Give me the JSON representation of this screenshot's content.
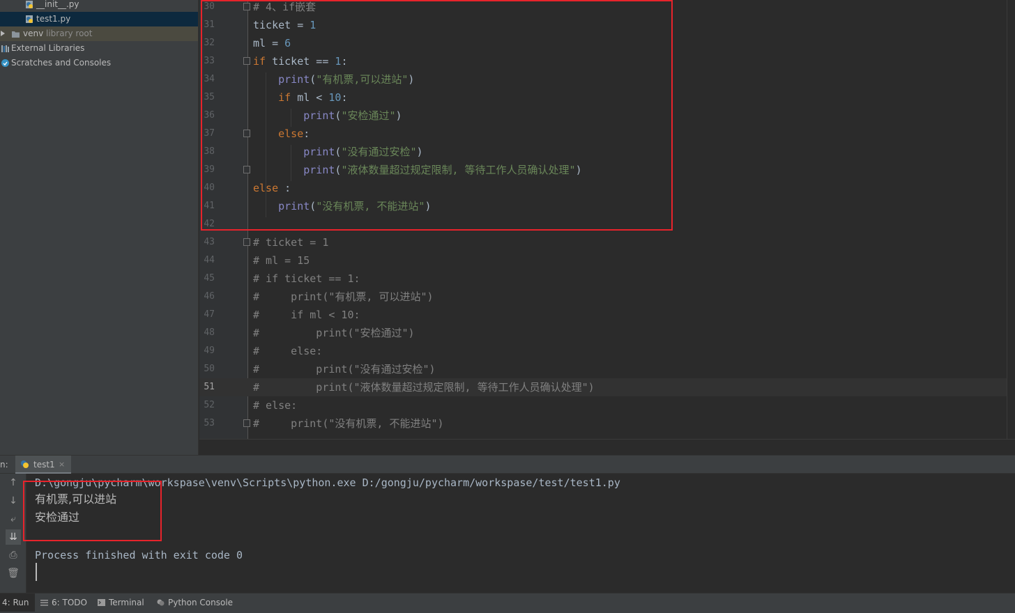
{
  "project_tree": {
    "items": [
      {
        "label": "__init__.py",
        "icon": "python-file-icon"
      },
      {
        "label": "test1.py",
        "icon": "python-file-icon"
      },
      {
        "label": "venv",
        "hint": "library root",
        "icon": "folder-icon"
      },
      {
        "label": "External Libraries",
        "icon": "libraries-icon"
      },
      {
        "label": "Scratches and Consoles",
        "icon": "scratches-icon"
      }
    ]
  },
  "editor": {
    "current_line": "51",
    "lines": [
      {
        "n": "30",
        "tokens": [
          {
            "t": "# 4、if嵌套",
            "c": "cmt"
          }
        ]
      },
      {
        "n": "31",
        "tokens": [
          {
            "t": "ticket = ",
            "c": ""
          },
          {
            "t": "1",
            "c": "num"
          }
        ]
      },
      {
        "n": "32",
        "tokens": [
          {
            "t": "ml = ",
            "c": ""
          },
          {
            "t": "6",
            "c": "num"
          }
        ]
      },
      {
        "n": "33",
        "tokens": [
          {
            "t": "if ",
            "c": "kw"
          },
          {
            "t": "ticket == ",
            "c": ""
          },
          {
            "t": "1",
            "c": "num"
          },
          {
            "t": ":",
            "c": ""
          }
        ]
      },
      {
        "n": "34",
        "tokens": [
          {
            "t": "    ",
            "c": ""
          },
          {
            "t": "print",
            "c": "fn"
          },
          {
            "t": "(",
            "c": ""
          },
          {
            "t": "\"有机票,可以进站\"",
            "c": "str"
          },
          {
            "t": ")",
            "c": ""
          }
        ]
      },
      {
        "n": "35",
        "tokens": [
          {
            "t": "    ",
            "c": ""
          },
          {
            "t": "if ",
            "c": "kw"
          },
          {
            "t": "ml < ",
            "c": ""
          },
          {
            "t": "10",
            "c": "num"
          },
          {
            "t": ":",
            "c": ""
          }
        ]
      },
      {
        "n": "36",
        "tokens": [
          {
            "t": "        ",
            "c": ""
          },
          {
            "t": "print",
            "c": "fn"
          },
          {
            "t": "(",
            "c": ""
          },
          {
            "t": "\"安检通过\"",
            "c": "str"
          },
          {
            "t": ")",
            "c": ""
          }
        ]
      },
      {
        "n": "37",
        "tokens": [
          {
            "t": "    ",
            "c": ""
          },
          {
            "t": "else",
            "c": "kw"
          },
          {
            "t": ":",
            "c": ""
          }
        ]
      },
      {
        "n": "38",
        "tokens": [
          {
            "t": "        ",
            "c": ""
          },
          {
            "t": "print",
            "c": "fn"
          },
          {
            "t": "(",
            "c": ""
          },
          {
            "t": "\"没有通过安检\"",
            "c": "str"
          },
          {
            "t": ")",
            "c": ""
          }
        ]
      },
      {
        "n": "39",
        "tokens": [
          {
            "t": "        ",
            "c": ""
          },
          {
            "t": "print",
            "c": "fn"
          },
          {
            "t": "(",
            "c": ""
          },
          {
            "t": "\"液体数量超过规定限制, 等待工作人员确认处理\"",
            "c": "str"
          },
          {
            "t": ")",
            "c": ""
          }
        ]
      },
      {
        "n": "40",
        "tokens": [
          {
            "t": "else",
            "c": "kw"
          },
          {
            "t": " :",
            "c": ""
          }
        ]
      },
      {
        "n": "41",
        "tokens": [
          {
            "t": "    ",
            "c": ""
          },
          {
            "t": "print",
            "c": "fn"
          },
          {
            "t": "(",
            "c": ""
          },
          {
            "t": "\"没有机票, 不能进站\"",
            "c": "str"
          },
          {
            "t": ")",
            "c": ""
          }
        ]
      },
      {
        "n": "42",
        "tokens": []
      },
      {
        "n": "43",
        "tokens": [
          {
            "t": "# ticket = 1",
            "c": "cmt"
          }
        ]
      },
      {
        "n": "44",
        "tokens": [
          {
            "t": "# ml = 15",
            "c": "cmt"
          }
        ]
      },
      {
        "n": "45",
        "tokens": [
          {
            "t": "# if ticket == 1:",
            "c": "cmt"
          }
        ]
      },
      {
        "n": "46",
        "tokens": [
          {
            "t": "#     print(\"有机票, 可以进站\")",
            "c": "cmt"
          }
        ]
      },
      {
        "n": "47",
        "tokens": [
          {
            "t": "#     if ml < 10:",
            "c": "cmt"
          }
        ]
      },
      {
        "n": "48",
        "tokens": [
          {
            "t": "#         print(\"安检通过\")",
            "c": "cmt"
          }
        ]
      },
      {
        "n": "49",
        "tokens": [
          {
            "t": "#     else:",
            "c": "cmt"
          }
        ]
      },
      {
        "n": "50",
        "tokens": [
          {
            "t": "#         print(\"没有通过安检\")",
            "c": "cmt"
          }
        ]
      },
      {
        "n": "51",
        "tokens": [
          {
            "t": "#         print(\"液体数量超过规定限制, 等待工作人员确认处理\")",
            "c": "cmt"
          }
        ]
      },
      {
        "n": "52",
        "tokens": [
          {
            "t": "# else:",
            "c": "cmt"
          }
        ]
      },
      {
        "n": "53",
        "tokens": [
          {
            "t": "#     print(\"没有机票, 不能进站\")",
            "c": "cmt"
          }
        ]
      }
    ]
  },
  "run_panel": {
    "title": "n:",
    "tab_label": "test1",
    "close_glyph": "×",
    "output": {
      "command": "D:\\gongju\\pycharm\\workspase\\venv\\Scripts\\python.exe D:/gongju/pycharm/workspase/test/test1.py",
      "line1": "有机票,可以进站",
      "line2": "安检通过",
      "exit_message": "Process finished with exit code 0"
    },
    "toolbar": {
      "up": "↑",
      "down": "↓",
      "wrap": "⤶",
      "scroll_end": "⇊",
      "print": "⎙",
      "clear": "🗑"
    }
  },
  "bottom_tabs": [
    {
      "label": "4: Run",
      "icon": "run-icon"
    },
    {
      "label": "6: TODO",
      "icon": "todo-icon"
    },
    {
      "label": "Terminal",
      "icon": "terminal-icon"
    },
    {
      "label": "Python Console",
      "icon": "python-console-icon"
    }
  ],
  "colors": {
    "highlight_border": "#e8232b",
    "keyword": "#cc7832",
    "builtin": "#8888c6",
    "string": "#6a8759",
    "number": "#6897bb",
    "comment": "#808080"
  }
}
